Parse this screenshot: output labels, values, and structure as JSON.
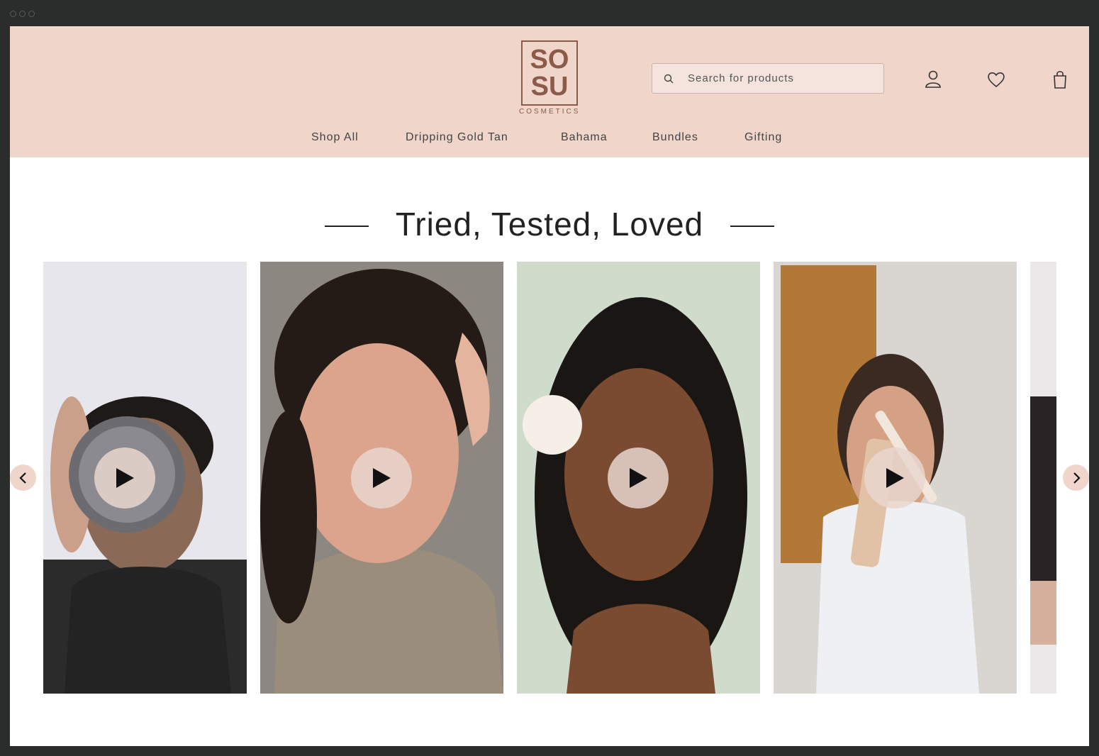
{
  "brand": {
    "logo_top": "SO",
    "logo_bottom": "SU",
    "logo_sub": "COSMETICS"
  },
  "search": {
    "placeholder": "Search for products"
  },
  "icons": {
    "search": "search-icon",
    "account": "user-icon",
    "wishlist": "heart-icon",
    "cart": "shopping-bag-icon",
    "play": "play-icon",
    "prev": "chevron-left-icon",
    "next": "chevron-right-icon"
  },
  "nav": [
    {
      "label": "Shop All"
    },
    {
      "label": "Dripping Gold Tan"
    },
    {
      "label": "Bahama"
    },
    {
      "label": "Bundles"
    },
    {
      "label": "Gifting"
    }
  ],
  "section": {
    "title": "Tried, Tested, Loved"
  },
  "colors": {
    "header_bg": "#efd5ca",
    "brand": "#8b5a48",
    "play_bg": "#e8d6ce"
  }
}
